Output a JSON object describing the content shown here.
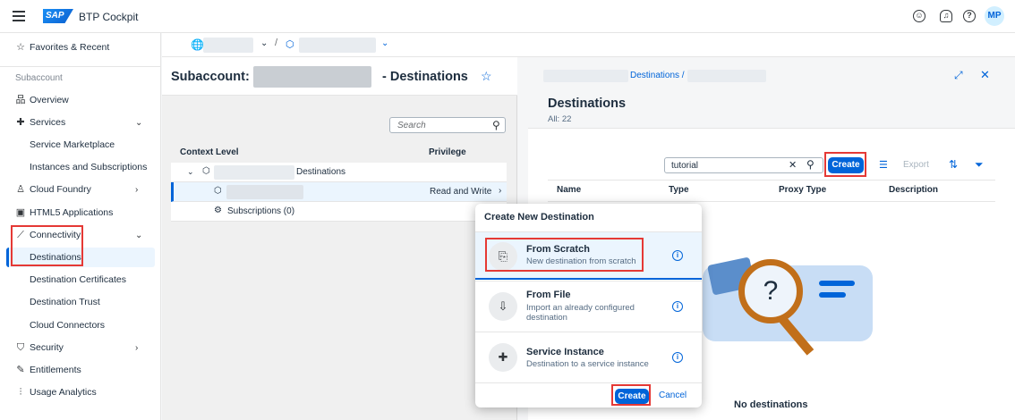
{
  "shell": {
    "logo": "SAP",
    "app_name": "BTP Cockpit",
    "avatar": "MP"
  },
  "sidebar": {
    "favorites": "Favorites & Recent",
    "group_title": "Subaccount",
    "items": [
      {
        "label": "Overview",
        "icon": "org-icon"
      },
      {
        "label": "Services",
        "icon": "services-icon"
      },
      {
        "label": "Service Marketplace"
      },
      {
        "label": "Instances and Subscriptions"
      },
      {
        "label": "Cloud Foundry",
        "icon": "cloud-foundry-icon"
      },
      {
        "label": "HTML5 Applications",
        "icon": "html5-icon"
      },
      {
        "label": "Connectivity",
        "icon": "connectivity-icon"
      },
      {
        "label": "Destinations"
      },
      {
        "label": "Destination Certificates"
      },
      {
        "label": "Destination Trust"
      },
      {
        "label": "Cloud Connectors"
      },
      {
        "label": "Security",
        "icon": "shield-icon"
      },
      {
        "label": "Entitlements",
        "icon": "entitlements-icon"
      },
      {
        "label": "Usage Analytics",
        "icon": "analytics-icon"
      }
    ]
  },
  "breadcrumb_sep": "/",
  "pane1": {
    "title_prefix": "Subaccount:",
    "title_suffix": "- Destinations",
    "search_placeholder": "Search",
    "col_context": "Context Level",
    "col_privilege": "Privilege",
    "row1_label": "Destinations",
    "row2_privilege": "Read and Write",
    "row3_label": "Subscriptions (0)"
  },
  "pane2": {
    "breadcrumb": "Destinations /",
    "title": "Destinations",
    "count": "All: 22",
    "search_value": "tutorial",
    "create": "Create",
    "export": "Export",
    "columns": [
      "Name",
      "Type",
      "Proxy Type",
      "Description"
    ],
    "empty": "No destinations"
  },
  "dialog": {
    "title": "Create New Destination",
    "options": [
      {
        "title": "From Scratch",
        "desc": "New destination from scratch"
      },
      {
        "title": "From File",
        "desc": "Import an already configured destination"
      },
      {
        "title": "Service Instance",
        "desc": "Destination to a service instance"
      }
    ],
    "create": "Create",
    "cancel": "Cancel"
  },
  "colors": {
    "accent": "#0064d9",
    "highlight": "#e53935"
  }
}
